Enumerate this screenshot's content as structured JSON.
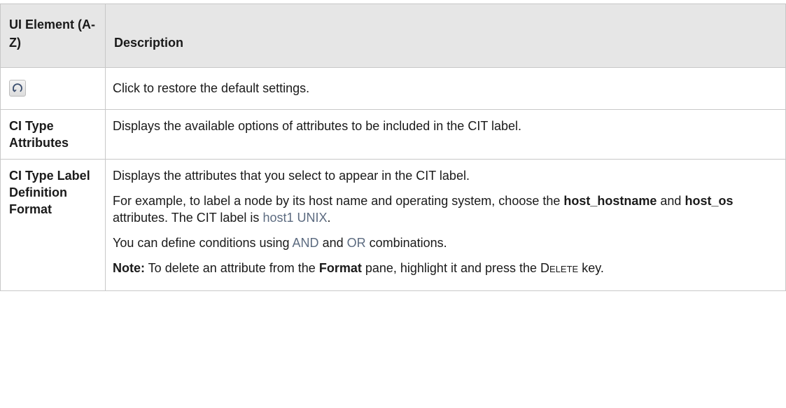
{
  "table": {
    "headers": {
      "ui_element": "UI Element (A-Z)",
      "description": "Description"
    },
    "rows": [
      {
        "icon": "restore-defaults-icon",
        "description": "Click to restore the default settings."
      },
      {
        "ui_element": "CI Type Attributes",
        "description": "Displays the available options of attributes to be included in the CIT label."
      },
      {
        "ui_element": "CI Type Label Definition Format",
        "paragraphs": [
          "Displays the attributes that you select to appear in the CIT label.",
          {
            "before": "For example, to label a node by its host name and operating system, choose the ",
            "bold1": "host_hostname",
            "between": " and ",
            "bold2": "host_os",
            "after_bold": " attributes. The CIT label is ",
            "example": "host1 UNIX",
            "end": "."
          },
          {
            "before": "You can define conditions using ",
            "and": "AND",
            "middle": " and ",
            "or": "OR",
            "after": " combinations."
          },
          {
            "note_label": "Note:",
            "before": " To delete an attribute from the ",
            "pane": "Format",
            "middle": " pane, highlight it and press the ",
            "key": "Delete",
            "after": " key."
          }
        ]
      }
    ]
  }
}
